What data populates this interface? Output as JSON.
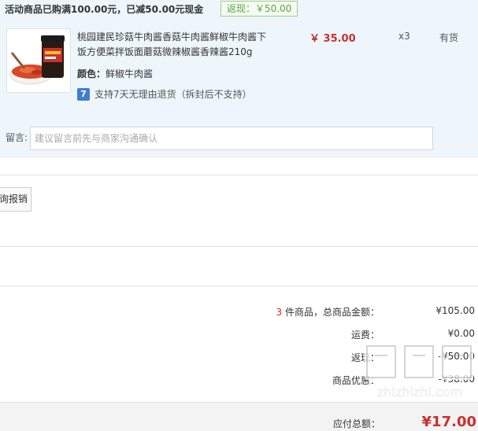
{
  "promo": {
    "text": "活动商品已购满100.00元，已减50.00元现金",
    "rebate_tag": "返现：￥50.00"
  },
  "product": {
    "title": "桃园建民珍菇牛肉酱香菇牛肉酱鲜椒牛肉酱下饭方便菜拌饭面蘑菇微辣椒酱香辣酱210g",
    "color_label": "颜色：",
    "color_value": "鲜椒牛肉酱",
    "return_policy": "支持7天无理由退货（拆封后不支持）",
    "return_icon": "7",
    "price": "￥ 35.00",
    "quantity": "x3",
    "stock": "有货"
  },
  "remark": {
    "label": "留言:",
    "placeholder": "建议留言前先与商家沟通确认"
  },
  "reimburse": {
    "label": "询报销"
  },
  "summary": {
    "count": "3",
    "count_suffix": " 件商品，总商品金额：",
    "total_value": "¥105.00",
    "shipping_label": "运费：",
    "shipping_value": "¥0.00",
    "rebate_label": "返现：",
    "rebate_value": "-¥50.00",
    "discount_label": "商品优惠：",
    "discount_value": "-¥38.00"
  },
  "footer": {
    "payable_label": "应付总额：",
    "payable_value": "¥17.00"
  },
  "watermark": {
    "text": "zhizhizhi.com"
  },
  "colors": {
    "panel_bg": "#eef6fb",
    "price_red": "#c9302c",
    "rebate_green": "#58a842",
    "footer_bg": "#f3f3f3"
  }
}
